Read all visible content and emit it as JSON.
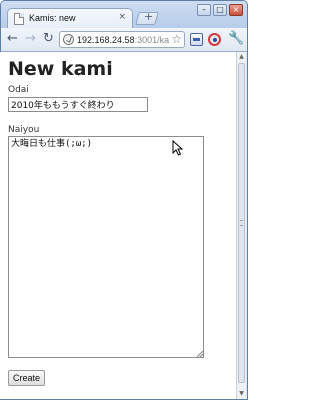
{
  "browser": {
    "tab_title": "Kamis: new",
    "tab_close": "×",
    "new_tab": "+",
    "url_host": "192.168.24.58",
    "url_rest": ":3001/kamis/new",
    "window_buttons": {
      "minimize": "–",
      "maximize": "□",
      "close": "×"
    }
  },
  "page": {
    "title": "New kami",
    "odai": {
      "label": "Odai",
      "value": "2010年ももうすぐ終わり"
    },
    "naiyou": {
      "label": "Naiyou",
      "value": "大晦日も仕事(;ω;)"
    },
    "create_button": "Create"
  },
  "icons": {
    "back": "back-arrow-icon",
    "forward": "forward-arrow-icon",
    "reload": "reload-icon",
    "star": "bookmark-star-icon",
    "wrench": "wrench-menu-icon"
  }
}
